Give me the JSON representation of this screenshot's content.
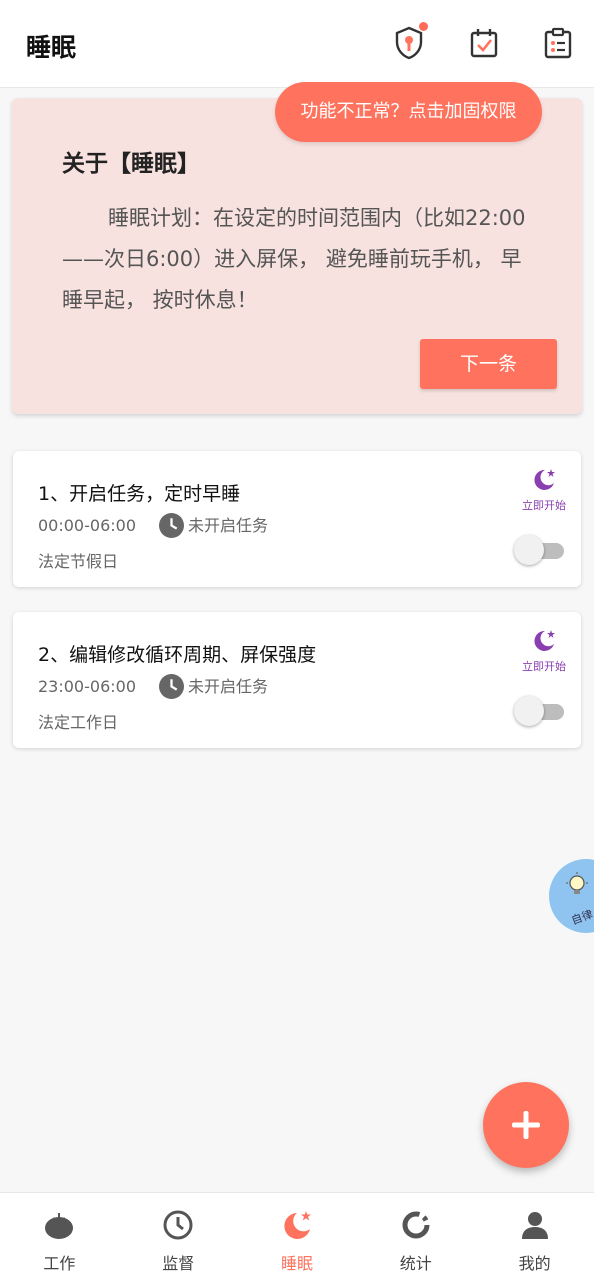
{
  "header": {
    "title": "睡眠",
    "icons": [
      "shield-key-icon",
      "calendar-check-icon",
      "clipboard-list-icon"
    ]
  },
  "tip": {
    "text": "功能不正常？点击加固权限"
  },
  "about": {
    "title": "关于【睡眠】",
    "text": "睡眠计划：在设定的时间范围内（比如22:00——次日6:00）进入屏保， 避免睡前玩手机， 早睡早起， 按时休息！",
    "next_label": "下一条"
  },
  "tasks": [
    {
      "title": "1、开启任务，定时早睡",
      "time": "00:00-06:00",
      "status": "未开启任务",
      "day": "法定节假日",
      "start_label": "立即开始",
      "enabled": false
    },
    {
      "title": "2、编辑修改循环周期、屏保强度",
      "time": "23:00-06:00",
      "status": "未开启任务",
      "day": "法定工作日",
      "start_label": "立即开始",
      "enabled": false
    }
  ],
  "floating": {
    "label": "自律"
  },
  "nav": {
    "items": [
      {
        "label": "工作",
        "icon": "tomato-icon"
      },
      {
        "label": "监督",
        "icon": "clock-icon"
      },
      {
        "label": "睡眠",
        "icon": "moon-icon",
        "active": true
      },
      {
        "label": "统计",
        "icon": "ring-chart-icon"
      },
      {
        "label": "我的",
        "icon": "user-icon"
      }
    ]
  },
  "colors": {
    "accent": "#ff735e",
    "moon": "#8a3fb0",
    "card_pink": "#f7e2df"
  }
}
